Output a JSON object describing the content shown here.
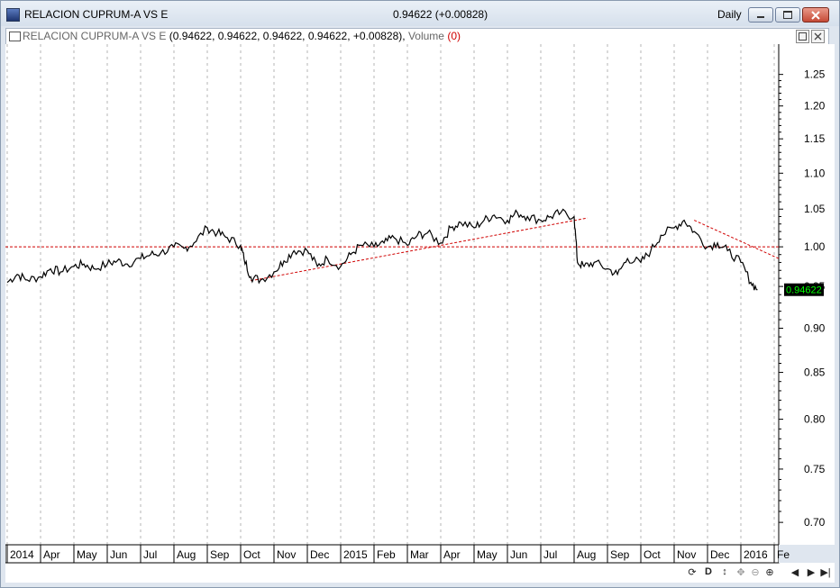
{
  "window": {
    "title": "RELACION CUPRUM-A VS E",
    "price_change": "0.94622 (+0.00828)",
    "period": "Daily",
    "icon": "chart-app-icon",
    "buttons": {
      "minimize": "minimize-icon",
      "restore": "restore-icon",
      "close": "close-icon"
    }
  },
  "panel": {
    "legend_series": "RELACION CUPRUM-A VS E",
    "legend_values": "(0.94622, 0.94622, 0.94622, 0.94622, +0.00828),",
    "legend_volume": "Volume",
    "legend_volume_value": "(0)",
    "buttons": {
      "maximize": "maximize-icon",
      "close": "close-icon"
    }
  },
  "nav": [
    "refresh-icon",
    "D",
    "up-down-arrow-icon",
    "move-icon",
    "zoom-out-icon",
    "zoom-in-icon",
    "scroll-left-icon",
    "scroll-right-icon",
    "scroll-end-icon"
  ],
  "chart_data": {
    "type": "line",
    "x_tick_labels": [
      "2014",
      "Apr",
      "May",
      "Jun",
      "Jul",
      "Aug",
      "Sep",
      "Oct",
      "Nov",
      "Dec",
      "2015",
      "Feb",
      "Mar",
      "Apr",
      "May",
      "Jun",
      "Jul",
      "Aug",
      "Sep",
      "Oct",
      "Nov",
      "Dec",
      "2016",
      "Fe"
    ],
    "y_tick_labels": [
      "1.25",
      "1.20",
      "1.15",
      "1.10",
      "1.05",
      "1.00",
      "0.95",
      "0.90",
      "0.85",
      "0.80",
      "0.75",
      "0.70"
    ],
    "y_ticks": [
      1.25,
      1.2,
      1.15,
      1.1,
      1.05,
      1.0,
      0.95,
      0.9,
      0.85,
      0.8,
      0.75,
      0.7
    ],
    "y_scale": "log",
    "ylim": [
      0.68,
      1.3
    ],
    "last_value_label": "0.94622",
    "colors": {
      "line": "#000000",
      "annotation": "#d00000",
      "grid": "#b4b4b4",
      "last_value_bg": "#000000",
      "last_value_fg": "#00ff00"
    },
    "series": [
      {
        "x_month_index": [
          0,
          0.3,
          0.6,
          1,
          1.3,
          1.6,
          2,
          2.3,
          2.6,
          3,
          3.3,
          3.6,
          4,
          4.3,
          4.6,
          5,
          5.3,
          5.6,
          6,
          6.3,
          6.6,
          7,
          7.1,
          7.3,
          7.6,
          8,
          8.3,
          8.6,
          9,
          9.3,
          9.6,
          10,
          10.3,
          10.6,
          11,
          11.3,
          11.6,
          12,
          12.3,
          12.6,
          13,
          13.3,
          13.6,
          14,
          14.3,
          14.6,
          15,
          15.3,
          15.6,
          16,
          16.3,
          16.6,
          17,
          17.1,
          17.3,
          17.6,
          18,
          18.3,
          18.6,
          19,
          19.3,
          19.6,
          20,
          20.3,
          20.6,
          21,
          21.3,
          21.6,
          22,
          22.3,
          22.5
        ],
        "values": [
          0.955,
          0.965,
          0.958,
          0.962,
          0.972,
          0.968,
          0.975,
          0.978,
          0.972,
          0.978,
          0.982,
          0.978,
          0.985,
          0.99,
          0.992,
          1.0,
          0.998,
          1.005,
          1.025,
          1.018,
          1.012,
          1.002,
          0.985,
          0.962,
          0.958,
          0.968,
          0.982,
          0.995,
          0.995,
          0.975,
          0.985,
          0.975,
          0.99,
          1.002,
          1.0,
          1.005,
          1.012,
          1.002,
          1.015,
          1.018,
          1.005,
          1.025,
          1.032,
          1.025,
          1.035,
          1.042,
          1.035,
          1.045,
          1.04,
          1.035,
          1.04,
          1.045,
          1.04,
          0.98,
          0.975,
          0.98,
          0.972,
          0.965,
          0.985,
          0.98,
          0.995,
          1.015,
          1.025,
          1.035,
          1.02,
          1.0,
          1.005,
          0.995,
          0.98,
          0.955,
          0.946
        ]
      }
    ],
    "annotations": [
      {
        "type": "horizontal-line",
        "y": 1.0
      },
      {
        "type": "trend-line",
        "from": [
          7.3,
          0.957
        ],
        "to": [
          17.4,
          1.038
        ]
      },
      {
        "type": "trend-line",
        "from": [
          20.6,
          1.035
        ],
        "to": [
          23.5,
          0.985
        ]
      }
    ]
  }
}
